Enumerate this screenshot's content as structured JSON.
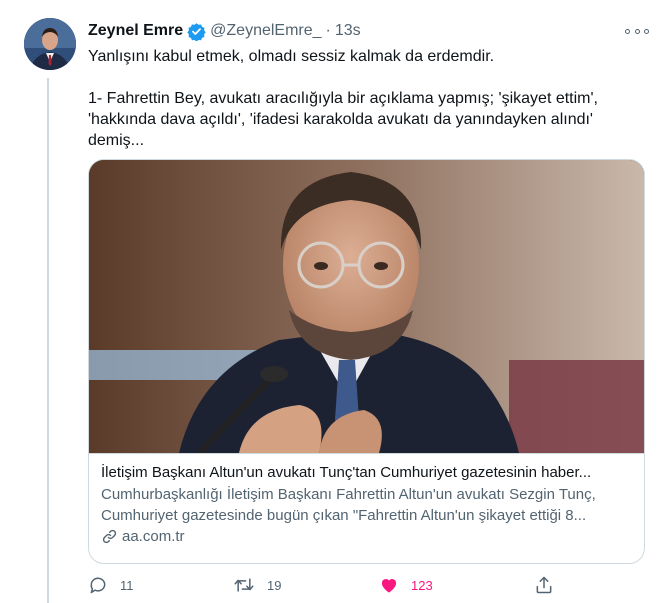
{
  "author": {
    "name": "Zeynel Emre",
    "handle": "@ZeynelEmre_",
    "separator": "·",
    "time": "13s"
  },
  "tweet": {
    "line1": "Yanlışını kabul etmek, olmadı sessiz kalmak da erdemdir.",
    "line2": "1- Fahrettin Bey, avukatı aracılığıyla bir açıklama yapmış; 'şikayet ettim',",
    "line3": "'hakkında dava açıldı', 'ifadesi karakolda avukatı da yanındayken alındı'",
    "line4": "demiş..."
  },
  "card": {
    "title": "İletişim Başkanı Altun'un avukatı Tunç'tan Cumhuriyet gazetesinin haber...",
    "desc_line1": "Cumhurbaşkanlığı İletişim Başkanı Fahrettin Altun'un avukatı Sezgin Tunç,",
    "desc_line2": "Cumhuriyet gazetesinde bugün çıkan \"Fahrettin Altun'un şikayet ettiği 8...",
    "domain": "aa.com.tr"
  },
  "actions": {
    "replies": "11",
    "retweets": "19",
    "likes": "123"
  },
  "colors": {
    "verified": "#1d9bf0",
    "like": "#f91880",
    "secondary_text": "#536471",
    "border": "#cfd9de"
  }
}
